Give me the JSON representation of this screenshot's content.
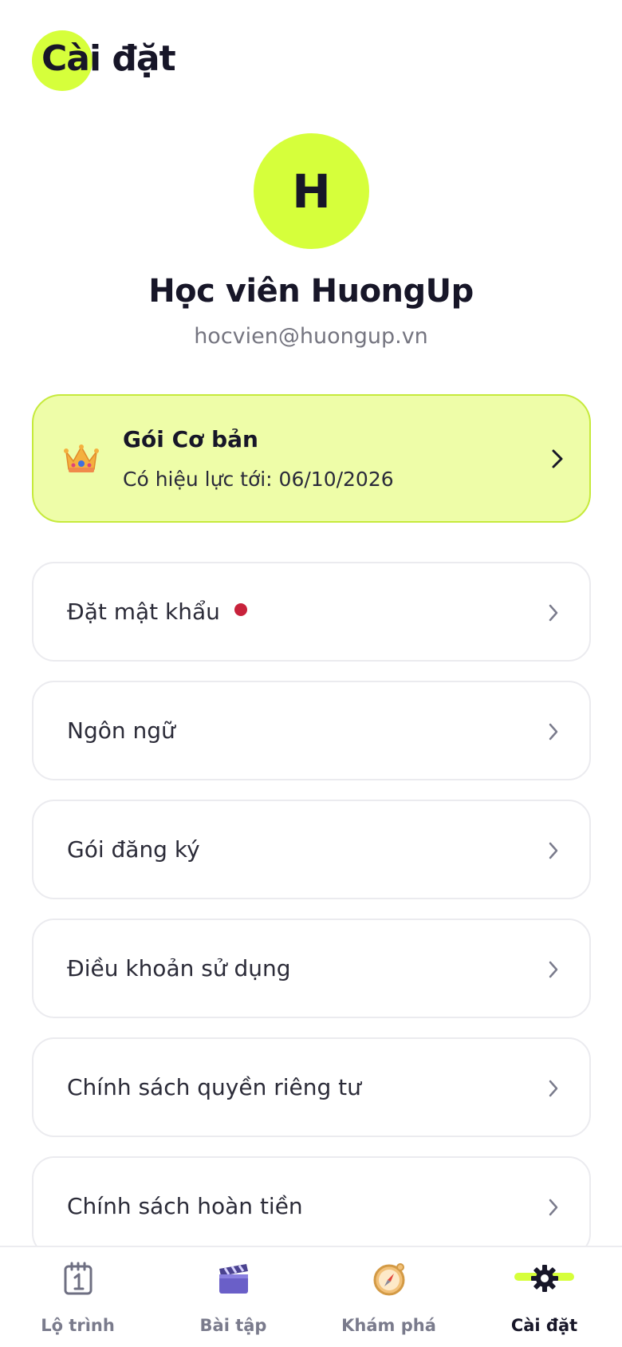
{
  "header": {
    "title": "Cài đặt"
  },
  "profile": {
    "avatar_initial": "H",
    "name": "Học viên HuongUp",
    "email": "hocvien@huongup.vn"
  },
  "plan": {
    "title": "Gói Cơ bản",
    "expiry": "Có hiệu lực tới: 06/10/2026",
    "icon": "crown-icon"
  },
  "menu": [
    {
      "label": "Đặt mật khẩu",
      "has_alert_dot": true
    },
    {
      "label": "Ngôn ngữ"
    },
    {
      "label": "Gói đăng ký"
    },
    {
      "label": "Điều khoản sử dụng"
    },
    {
      "label": "Chính sách quyền riêng tư"
    },
    {
      "label": "Chính sách hoàn tiền"
    }
  ],
  "nav": [
    {
      "label": "Lộ trình",
      "icon": "calendar-icon"
    },
    {
      "label": "Bài tập",
      "icon": "clapperboard-icon"
    },
    {
      "label": "Khám phá",
      "icon": "compass-icon"
    },
    {
      "label": "Cài đặt",
      "icon": "gear-icon",
      "active": true
    }
  ],
  "colors": {
    "accent": "#d6ff3b",
    "plan_bg": "#eefda8",
    "alert_dot": "#c8223b",
    "text_dark": "#171628"
  }
}
